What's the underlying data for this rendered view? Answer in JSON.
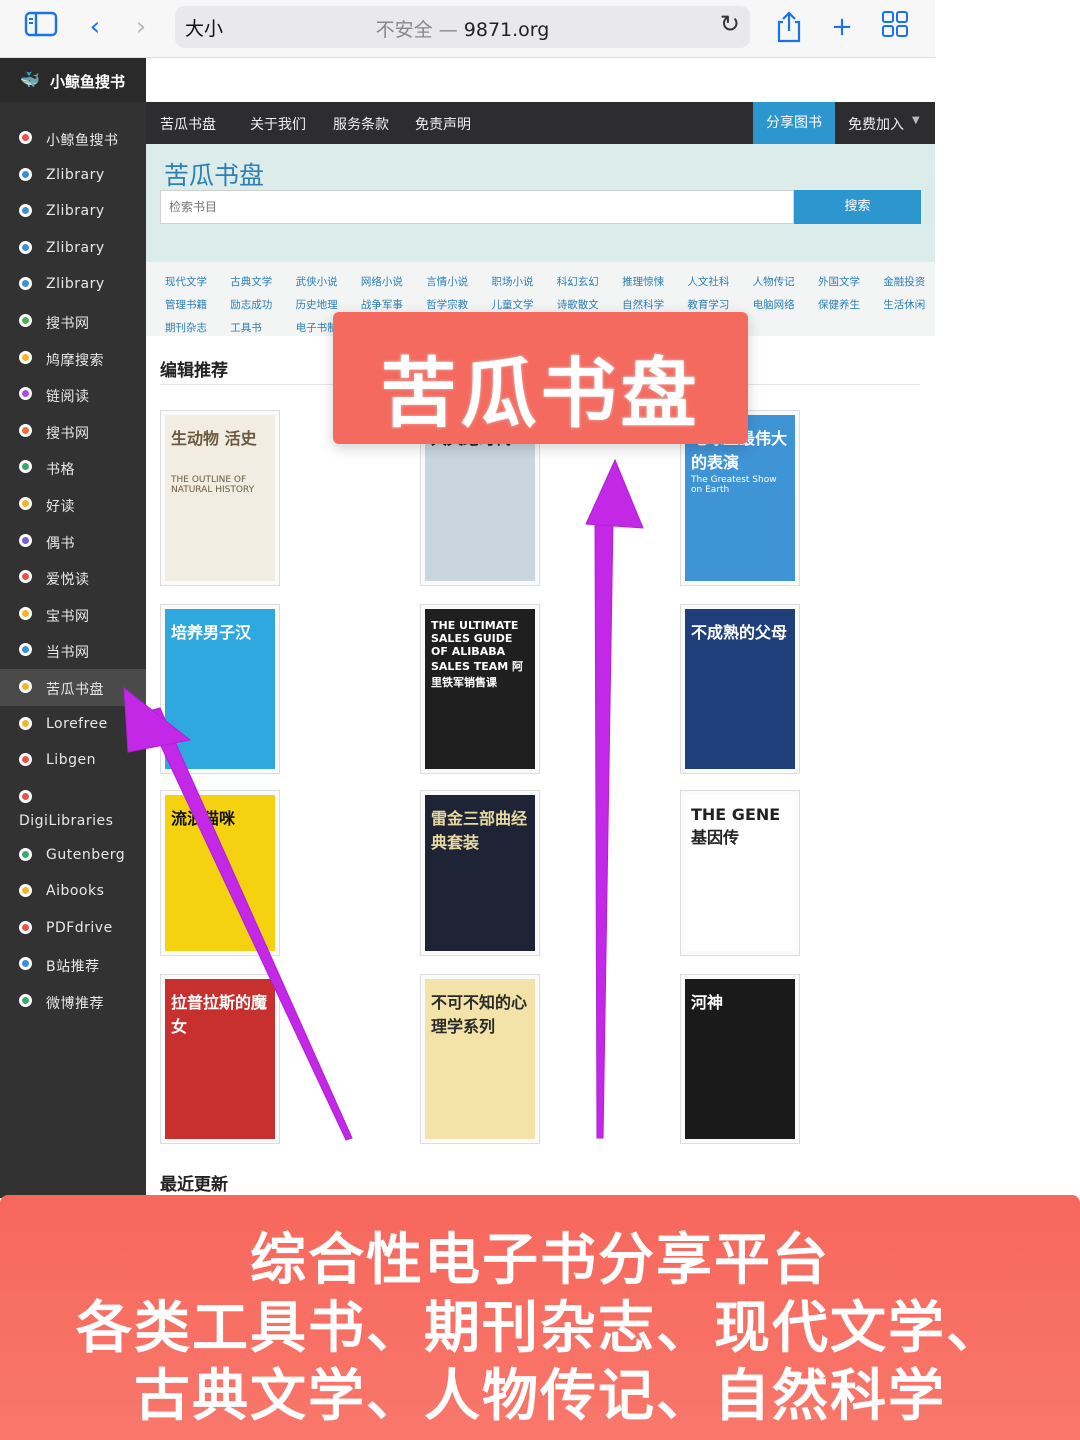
{
  "browser": {
    "size_button": "大小",
    "url_prefix": "不安全 — ",
    "url_domain": "9871.org",
    "icons": [
      "sidebar-icon",
      "back-icon",
      "forward-icon",
      "reload-icon",
      "share-icon",
      "add-tab-icon",
      "tabs-grid-icon"
    ]
  },
  "sidebar": {
    "brand": "小鲸鱼搜书",
    "items": [
      {
        "label": "小鲸鱼搜书",
        "color": "#e5534b"
      },
      {
        "label": "Zlibrary",
        "color": "#3a8fd6"
      },
      {
        "label": "Zlibrary",
        "color": "#3a8fd6"
      },
      {
        "label": "Zlibrary",
        "color": "#3a8fd6"
      },
      {
        "label": "Zlibrary",
        "color": "#3a8fd6"
      },
      {
        "label": "搜书网",
        "color": "#4caf50"
      },
      {
        "label": "鸠摩搜索",
        "color": "#f2b531"
      },
      {
        "label": "链阅读",
        "color": "#b04fd6"
      },
      {
        "label": "搜书网",
        "color": "#f26b3a"
      },
      {
        "label": "书格",
        "color": "#3aa76d"
      },
      {
        "label": "好读",
        "color": "#f2b531"
      },
      {
        "label": "偶书",
        "color": "#7b5bd6"
      },
      {
        "label": "爱悦读",
        "color": "#e5534b"
      },
      {
        "label": "宝书网",
        "color": "#f2b531"
      },
      {
        "label": "当书网",
        "color": "#3a8fd6"
      },
      {
        "label": "苦瓜书盘",
        "color": "#f2b531",
        "active": true
      },
      {
        "label": "Lorefree",
        "color": "#f2b531"
      },
      {
        "label": "Libgen",
        "color": "#e5534b"
      },
      {
        "label": "DigiLibraries",
        "color": "#e5534b"
      },
      {
        "label": "Gutenberg",
        "color": "#3aa76d"
      },
      {
        "label": "Aibooks",
        "color": "#f2b531"
      },
      {
        "label": "PDFdrive",
        "color": "#e5534b"
      },
      {
        "label": "B站推荐",
        "color": "#3a8fd6"
      },
      {
        "label": "微博推荐",
        "color": "#3aa76d"
      }
    ]
  },
  "site": {
    "nav": [
      "苦瓜书盘",
      "关于我们",
      "服务条款",
      "免责声明"
    ],
    "share_button": "分享图书",
    "join": "免费加入",
    "title": "苦瓜书盘",
    "search_placeholder": "检索书目",
    "search_button": "搜索",
    "categories": [
      [
        "现代文学",
        "古典文学",
        "武侠小说",
        "网络小说",
        "言情小说",
        "职场小说",
        "科幻玄幻",
        "推理惊悚",
        "人文社科",
        "人物传记",
        "外国文学",
        "金融投资"
      ],
      [
        "管理书籍",
        "励志成功",
        "历史地理",
        "战争军事",
        "哲学宗教",
        "儿童文学",
        "诗歌散文",
        "自然科学",
        "教育学习",
        "电脑网络",
        "保健养生",
        "生活休闲"
      ],
      [
        "期刊杂志",
        "工具书",
        "电子书制作"
      ]
    ],
    "section_editor": "编辑推荐",
    "section_latest": "最近更新",
    "books": [
      {
        "title": "生动物史",
        "cover_text": "生动物 活史",
        "sub": "THE OUTLINE OF NATURAL HISTORY",
        "bg": "#f1ede2",
        "fg": "#6b5a40"
      },
      {
        "title": "大灭绝时代",
        "cover_text": "大灭绝时代",
        "sub": "",
        "bg": "#c9d6e0",
        "fg": "#1d1d1d"
      },
      {
        "title": "The Greatest Show on Earth",
        "cover_text": "地球上最伟大的表演",
        "sub": "The Greatest Show on Earth",
        "bg": "#3f94d6",
        "fg": "#ffffff"
      },
      {
        "title": "培养男子汉",
        "cover_text": "培养男子汉",
        "sub": "",
        "bg": "#2fa8e0",
        "fg": "#ffffff"
      },
      {
        "title": "阿里铁军销售课",
        "cover_text": "THE ULTIMATE SALES GUIDE OF ALIBABA SALES TEAM 阿里铁军销售课",
        "sub": "",
        "bg": "#1f1f1f",
        "fg": "#ffffff"
      },
      {
        "title": "不成熟的父母",
        "cover_text": "不成熟的父母",
        "sub": "",
        "bg": "#1f3f7a",
        "fg": "#ffffff"
      },
      {
        "title": "流浪猫咪",
        "cover_text": "流浪猫咪",
        "sub": "",
        "bg": "#f5d20f",
        "fg": "#111111"
      },
      {
        "title": "雷金三部曲",
        "cover_text": "雷金三部曲经典套装",
        "sub": "",
        "bg": "#1e2436",
        "fg": "#e8d9a0"
      },
      {
        "title": "基因传",
        "cover_text": "THE GENE 基因传",
        "sub": "",
        "bg": "#ffffff",
        "fg": "#222222"
      },
      {
        "title": "拉普拉斯的魔女",
        "cover_text": "拉普拉斯的魔女",
        "sub": "",
        "bg": "#c7302e",
        "fg": "#ffffff"
      },
      {
        "title": "不可不知的心理学系列",
        "cover_text": "不可不知的心理学系列",
        "sub": "",
        "bg": "#f4e3a8",
        "fg": "#2a2a2a"
      },
      {
        "title": "河神",
        "cover_text": "河神",
        "sub": "",
        "bg": "#1a1a1a",
        "fg": "#ffffff"
      }
    ]
  },
  "overlay": {
    "top_banner": "苦瓜书盘",
    "bottom_lines": [
      "综合性电子书分享平台",
      "各类工具书、期刊杂志、现代文学、",
      "古典文学、人物传记、自然科学"
    ],
    "arrow_color": "#c228e6",
    "banner_color": "#f46a5e"
  }
}
